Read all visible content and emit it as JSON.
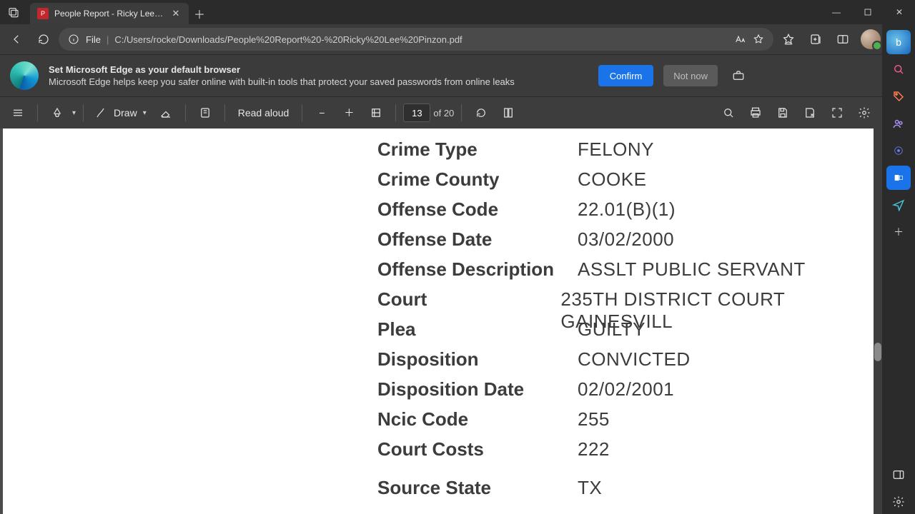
{
  "titlebar": {
    "tab_title": "People Report - Ricky Lee Pinzon"
  },
  "addressbar": {
    "file_label": "File",
    "path": "C:/Users/rocke/Downloads/People%20Report%20-%20Ricky%20Lee%20Pinzon.pdf"
  },
  "banner": {
    "title": "Set Microsoft Edge as your default browser",
    "subtitle": "Microsoft Edge helps keep you safer online with built-in tools that protect your saved passwords from online leaks",
    "confirm": "Confirm",
    "notnow": "Not now"
  },
  "pdf_toolbar": {
    "draw_label": "Draw",
    "read_aloud": "Read aloud",
    "page_current": "13",
    "page_total": "of 20"
  },
  "report": {
    "rows": [
      {
        "label": "Crime Type",
        "value": "FELONY"
      },
      {
        "label": "Crime County",
        "value": "COOKE"
      },
      {
        "label": "Offense Code",
        "value": "22.01(B)(1)"
      },
      {
        "label": "Offense Date",
        "value": "03/02/2000"
      },
      {
        "label": "Offense Description",
        "value": "ASSLT PUBLIC SERVANT"
      },
      {
        "label": "Court",
        "value": "235TH DISTRICT COURT GAINESVILL"
      },
      {
        "label": "Plea",
        "value": "GUILTY"
      },
      {
        "label": "Disposition",
        "value": "CONVICTED"
      },
      {
        "label": "Disposition Date",
        "value": "02/02/2001"
      },
      {
        "label": "Ncic Code",
        "value": "255"
      },
      {
        "label": "Court Costs",
        "value": "222"
      },
      {
        "label": "Source State",
        "value": "TX"
      }
    ]
  }
}
